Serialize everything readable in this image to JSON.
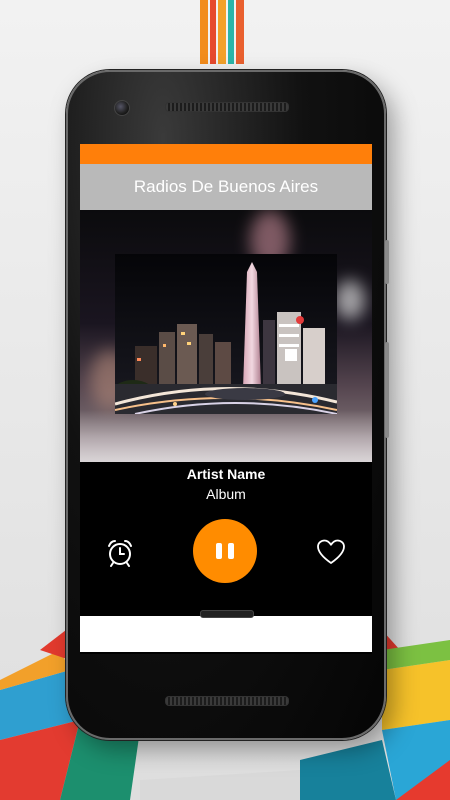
{
  "app": {
    "title": "Radios De Buenos Aires"
  },
  "now_playing": {
    "artist": "Artist Name",
    "album": "Album"
  },
  "controls": {
    "alarm_icon": "alarm-clock-icon",
    "play_pause_icon": "pause-icon",
    "favorite_icon": "heart-outline-icon"
  },
  "colors": {
    "accent": "#ff8c00",
    "status_bar": "#ff7f0a",
    "app_bar": "#b9b9b9",
    "screen_background": "#000000"
  }
}
